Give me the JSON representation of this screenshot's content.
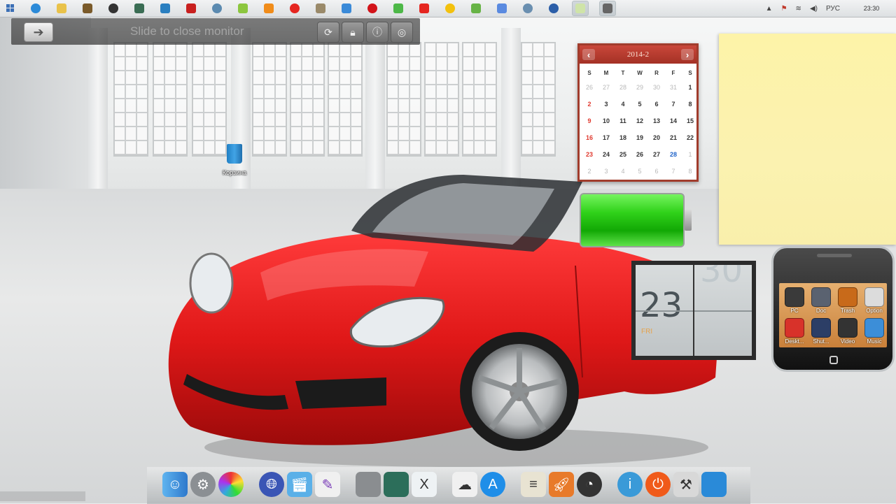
{
  "taskbar": {
    "language": "РУС",
    "clock": "23:30"
  },
  "slide_monitor": {
    "text": "Slide to close monitor",
    "arrow": "➔"
  },
  "desktop_icons": [
    {
      "label": "Корзина",
      "icon": "recycle-bin-icon"
    }
  ],
  "calendar": {
    "title": "2014-2",
    "prev": "‹",
    "next": "›",
    "weekdays": [
      "S",
      "M",
      "T",
      "W",
      "R",
      "F",
      "S"
    ],
    "weeks": [
      [
        "26",
        "27",
        "28",
        "29",
        "30",
        "31",
        "1"
      ],
      [
        "2",
        "3",
        "4",
        "5",
        "6",
        "7",
        "8"
      ],
      [
        "9",
        "10",
        "11",
        "12",
        "13",
        "14",
        "15"
      ],
      [
        "16",
        "17",
        "18",
        "19",
        "20",
        "21",
        "22"
      ],
      [
        "23",
        "24",
        "25",
        "26",
        "27",
        "28",
        "1"
      ],
      [
        "2",
        "3",
        "4",
        "5",
        "6",
        "7",
        "8"
      ]
    ],
    "today": "28"
  },
  "battery": {
    "level": 1.0,
    "color": "#2fcf1a"
  },
  "flip_clock": {
    "hour": "23",
    "minute": "30",
    "day": "FRI"
  },
  "phone": {
    "apps": [
      {
        "label": "PC",
        "icon": "pc-icon",
        "color": "#3a3a3a"
      },
      {
        "label": "Doc",
        "icon": "document-icon",
        "color": "#5a6270"
      },
      {
        "label": "Trash",
        "icon": "trash-icon",
        "color": "#c86a1a"
      },
      {
        "label": "Option",
        "icon": "option-icon",
        "color": "#dcdcdc"
      },
      {
        "label": "Deskt...",
        "icon": "desktop-icon",
        "color": "#d8322a"
      },
      {
        "label": "Shut...",
        "icon": "shutdown-icon",
        "color": "#2c3e66"
      },
      {
        "label": "Video",
        "icon": "video-icon",
        "color": "#333333"
      },
      {
        "label": "Music",
        "icon": "music-icon",
        "color": "#3c8ed8"
      }
    ]
  },
  "colors": {
    "calendar_accent": "#a43125",
    "note": "#fbf2b0"
  }
}
